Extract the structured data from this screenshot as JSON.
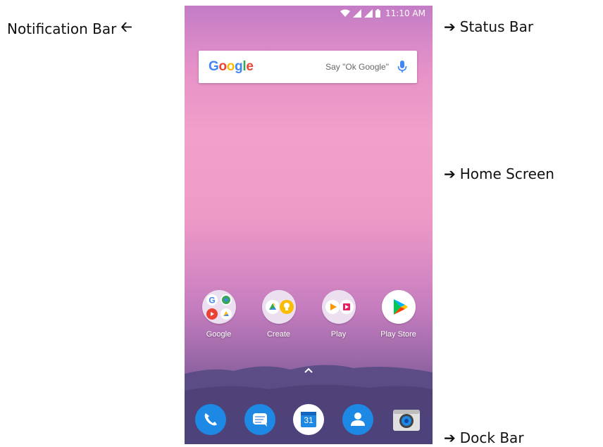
{
  "callouts": {
    "notification_bar": "Notification Bar",
    "status_bar": "Status Bar",
    "home_screen": "Home Screen",
    "dock_bar": "Dock Bar"
  },
  "status": {
    "time": "11:10 AM"
  },
  "search": {
    "logo": "Google",
    "hint": "Say \"Ok Google\""
  },
  "apps": [
    {
      "label": "Google",
      "icon": "google-folder-icon"
    },
    {
      "label": "Create",
      "icon": "create-folder-icon"
    },
    {
      "label": "Play",
      "icon": "play-folder-icon"
    },
    {
      "label": "Play Store",
      "icon": "play-store-icon"
    }
  ],
  "dock": [
    {
      "icon": "phone-icon"
    },
    {
      "icon": "messages-icon"
    },
    {
      "icon": "calendar-icon",
      "text": "31"
    },
    {
      "icon": "contacts-icon"
    },
    {
      "icon": "camera-icon"
    }
  ],
  "colors": {
    "google_blue": "#4285F4",
    "google_red": "#EA4335",
    "google_yellow": "#FBBC05",
    "google_green": "#34A853",
    "dock_blue": "#1e88e5"
  }
}
